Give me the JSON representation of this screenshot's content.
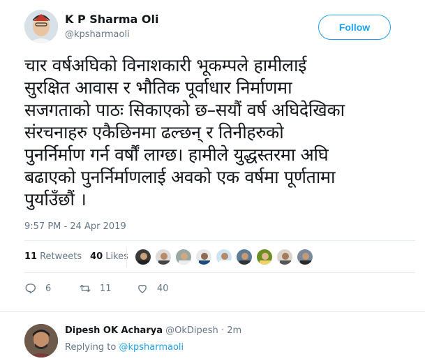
{
  "tweet": {
    "author_name": "K P Sharma Oli",
    "author_handle": "@kpsharmaoli",
    "follow_label": "Follow",
    "text_lines": [
      "चार वर्षअघिको विनाशकारी भूकम्पले हामीलाई",
      "सुरक्षित आवास र भौतिक पूर्वाधार निर्माणमा",
      "सजगताको पाठः सिकाएको छ–सयौं वर्ष अघिदेखिका",
      "संरचनाहरु एकैछिनमा ढल्छन् र तिनीहरुको",
      "पुनर्निर्माण गर्न वर्षौं लाग्छ। हामीले युद्धस्तरमा अघि",
      "बढाएको पुनर्निर्माणलाई अवको एक वर्षमा पूर्णतामा",
      "पुर्याउँछौं ।"
    ],
    "timestamp": "9:57 PM - 24 Apr 2019"
  },
  "stats": {
    "retweets_count": "11",
    "retweets_label": "Retweets",
    "likes_count": "40",
    "likes_label": "Likes"
  },
  "actions": {
    "replies": "6",
    "retweets": "11",
    "likes": "40"
  },
  "reply": {
    "author_name": "Dipesh OK Acharya",
    "author_handle": "@OkDipesh",
    "separator": "·",
    "time": "2m",
    "replying_prefix": "Replying to",
    "replying_handle": "@kpsharmaoli"
  },
  "colors": {
    "accent": "#1da1f2",
    "secondary_text": "#657786",
    "divider": "#e6ecf0"
  }
}
